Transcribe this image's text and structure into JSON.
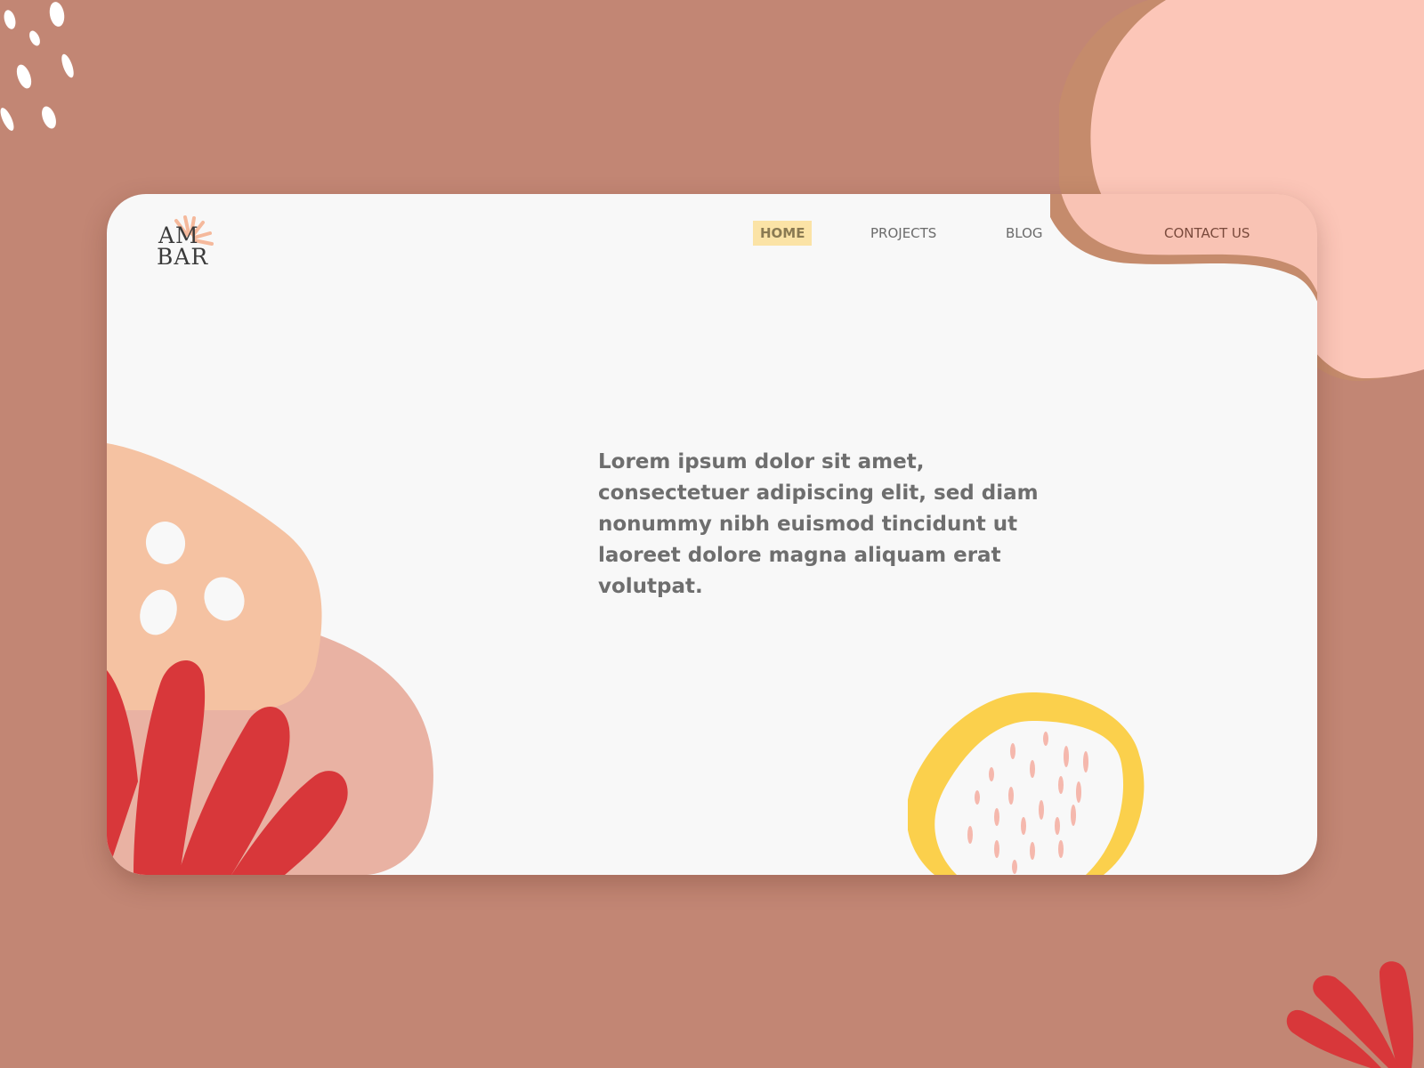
{
  "logo": {
    "line1": "AM",
    "line2": "BAR"
  },
  "nav": {
    "items": [
      {
        "label": "HOME",
        "active": true
      },
      {
        "label": "PROJECTS",
        "active": false
      },
      {
        "label": "BLOG",
        "active": false
      },
      {
        "label": "CONTACT US",
        "active": false
      }
    ]
  },
  "hero": {
    "text": "Lorem ipsum dolor sit amet, consectetuer adipiscing elit, sed diam nonummy nibh euismod tincidunt ut laoreet dolore magna aliquam erat volutpat."
  },
  "colors": {
    "background": "#c28674",
    "card": "#f8f8f8",
    "peach_blob": "#fcc6b8",
    "tan_outline": "#c58b6c",
    "light_orange": "#f5c2a2",
    "dusty_pink": "#e9b2a3",
    "red": "#d8373a",
    "yellow": "#fbd04c",
    "active_nav_bg": "#fbe3a6"
  },
  "icons": {
    "logo_burst": "sunburst-icon",
    "decorations": [
      "white-dots",
      "peach-blob",
      "red-leaves",
      "yellow-ring"
    ]
  }
}
